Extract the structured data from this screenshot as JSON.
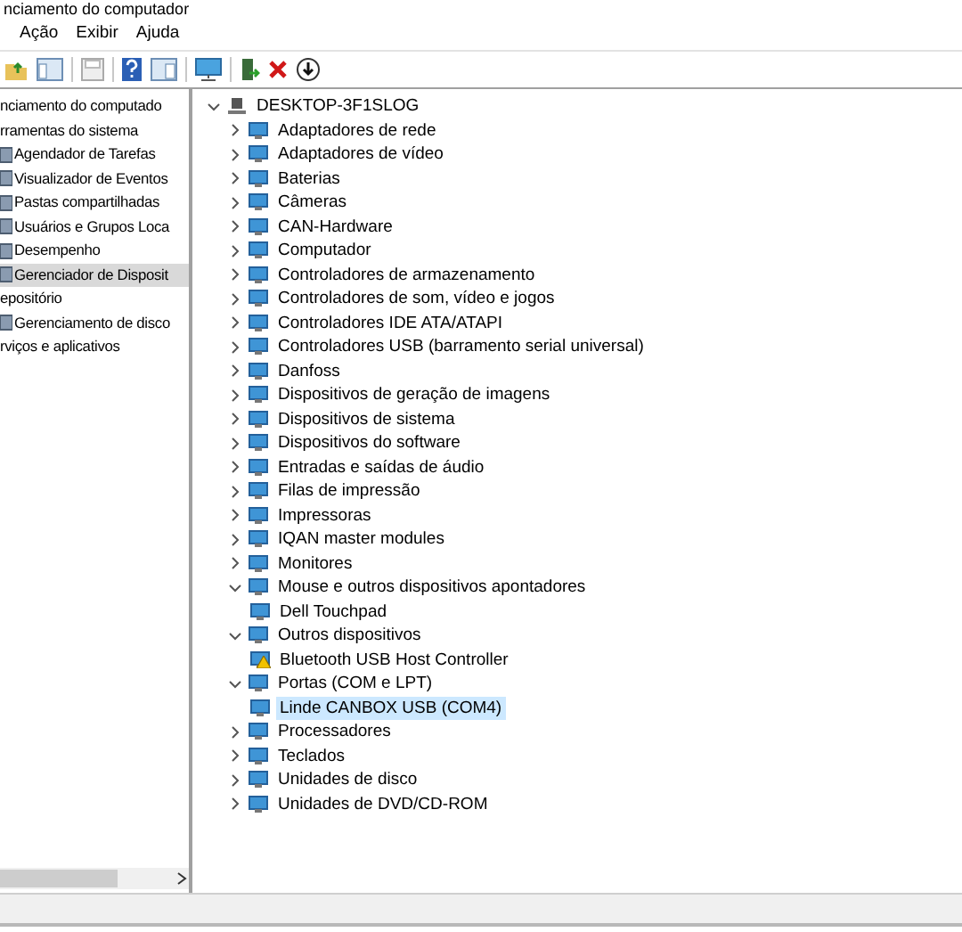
{
  "window": {
    "title": "nciamento do computador"
  },
  "menu": [
    "Ação",
    "Exibir",
    "Ajuda"
  ],
  "nav_tree": [
    {
      "label": "nciamento do computado",
      "selected": false,
      "children": [
        {
          "label": "rramentas do sistema",
          "selected": false,
          "children": [
            {
              "label": "Agendador de Tarefas",
              "selected": false
            },
            {
              "label": "Visualizador de Eventos",
              "selected": false
            },
            {
              "label": "Pastas compartilhadas",
              "selected": false
            },
            {
              "label": "Usuários e Grupos Loca",
              "selected": false
            },
            {
              "label": "Desempenho",
              "selected": false
            },
            {
              "label": "Gerenciador de Disposit",
              "selected": true
            }
          ]
        },
        {
          "label": "epositório",
          "selected": false,
          "children": [
            {
              "label": "Gerenciamento de disco",
              "selected": false
            }
          ]
        },
        {
          "label": "rviços e aplicativos",
          "selected": false
        }
      ]
    }
  ],
  "device_tree": [
    {
      "label": "DESKTOP-3F1SLOG",
      "expanded": true,
      "selected": false,
      "children": [
        {
          "label": "Adaptadores de rede",
          "expanded": false,
          "selected": false
        },
        {
          "label": "Adaptadores de vídeo",
          "expanded": false,
          "selected": false
        },
        {
          "label": "Baterias",
          "expanded": false,
          "selected": false
        },
        {
          "label": "Câmeras",
          "expanded": false,
          "selected": false
        },
        {
          "label": "CAN-Hardware",
          "expanded": false,
          "selected": false
        },
        {
          "label": "Computador",
          "expanded": false,
          "selected": false
        },
        {
          "label": "Controladores de armazenamento",
          "expanded": false,
          "selected": false
        },
        {
          "label": "Controladores de som, vídeo e jogos",
          "expanded": false,
          "selected": false
        },
        {
          "label": "Controladores IDE ATA/ATAPI",
          "expanded": false,
          "selected": false
        },
        {
          "label": "Controladores USB (barramento serial universal)",
          "expanded": false,
          "selected": false
        },
        {
          "label": "Danfoss",
          "expanded": false,
          "selected": false
        },
        {
          "label": "Dispositivos de geração de imagens",
          "expanded": false,
          "selected": false
        },
        {
          "label": "Dispositivos de sistema",
          "expanded": false,
          "selected": false
        },
        {
          "label": "Dispositivos do software",
          "expanded": false,
          "selected": false
        },
        {
          "label": "Entradas e saídas de áudio",
          "expanded": false,
          "selected": false
        },
        {
          "label": "Filas de impressão",
          "expanded": false,
          "selected": false
        },
        {
          "label": "Impressoras",
          "expanded": false,
          "selected": false
        },
        {
          "label": "IQAN master modules",
          "expanded": false,
          "selected": false
        },
        {
          "label": "Monitores",
          "expanded": false,
          "selected": false
        },
        {
          "label": "Mouse e outros dispositivos apontadores",
          "expanded": true,
          "selected": false,
          "children": [
            {
              "label": "Dell Touchpad",
              "selected": false,
              "warning": false
            }
          ]
        },
        {
          "label": "Outros dispositivos",
          "expanded": true,
          "selected": false,
          "children": [
            {
              "label": "Bluetooth USB Host Controller",
              "selected": false,
              "warning": true
            }
          ]
        },
        {
          "label": "Portas (COM e LPT)",
          "expanded": true,
          "selected": false,
          "children": [
            {
              "label": "Linde CANBOX USB (COM4)",
              "selected": true,
              "warning": false
            }
          ]
        },
        {
          "label": "Processadores",
          "expanded": false,
          "selected": false
        },
        {
          "label": "Teclados",
          "expanded": false,
          "selected": false
        },
        {
          "label": "Unidades de disco",
          "expanded": false,
          "selected": false
        },
        {
          "label": "Unidades de DVD/CD-ROM",
          "expanded": false,
          "selected": false
        }
      ]
    }
  ]
}
